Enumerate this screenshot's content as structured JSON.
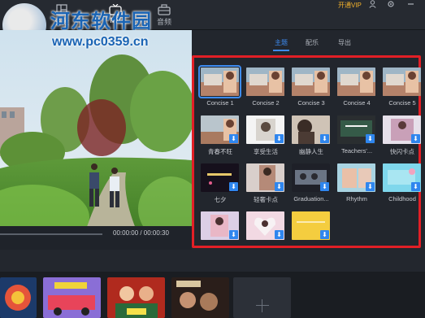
{
  "watermark": {
    "title": "河东软件园",
    "url": "www.pc0359.cn"
  },
  "nav": [
    {
      "label": "分段",
      "icon": "layout-icon"
    },
    {
      "label": "MV",
      "icon": "mv-tv-icon"
    },
    {
      "label": "音频",
      "icon": "briefcase-icon"
    }
  ],
  "topbar": {
    "vip_label": "开通VIP",
    "user_icon": "user-icon",
    "settings_icon": "gear-icon",
    "minimize_icon": "minimize-icon"
  },
  "player": {
    "time": "00:00:00 / 00:00:30"
  },
  "panel": {
    "tabs": [
      "主题",
      "配乐",
      "导出"
    ],
    "active_tab": "主题"
  },
  "themes": [
    {
      "label": "Concise 1",
      "selected": true
    },
    {
      "label": "Concise 2"
    },
    {
      "label": "Concise 3"
    },
    {
      "label": "Concise 4"
    },
    {
      "label": "Concise 5"
    },
    {
      "label": "青春不旺"
    },
    {
      "label": "享受生活"
    },
    {
      "label": "幽静人生"
    },
    {
      "label": "Teachers'..."
    },
    {
      "label": "快闪卡点"
    },
    {
      "label": "七夕"
    },
    {
      "label": "轻奢卡点"
    },
    {
      "label": "Graduation..."
    },
    {
      "label": "Rhythm"
    },
    {
      "label": "Childhood"
    },
    {
      "label": ""
    },
    {
      "label": ""
    },
    {
      "label": ""
    }
  ],
  "colors": {
    "accent": "#3d8bf0",
    "highlight_box": "#e21f26",
    "vip": "#f2b12c"
  }
}
